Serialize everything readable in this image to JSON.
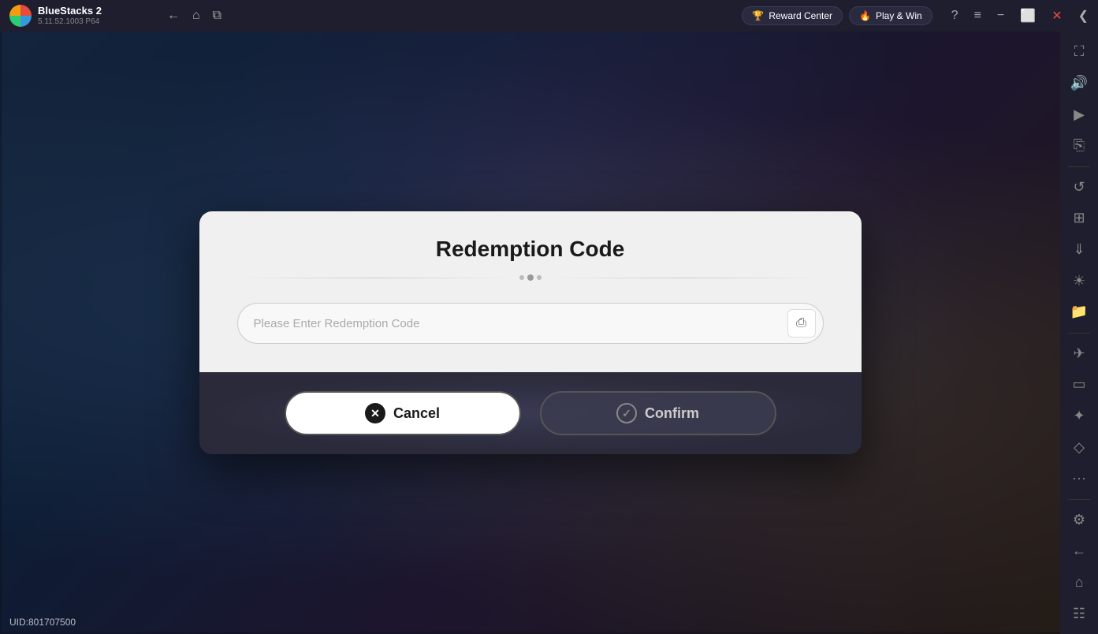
{
  "app": {
    "name": "BlueStacks 2",
    "version": "5.11.52.1003  P64"
  },
  "titlebar": {
    "back_label": "←",
    "home_label": "⌂",
    "copy_label": "⧉",
    "reward_center_label": "Reward Center",
    "play_win_label": "Play & Win",
    "help_label": "?",
    "menu_label": "≡",
    "minimize_label": "−",
    "restore_label": "⬜",
    "close_label": "✕",
    "arrow_label": "❮"
  },
  "sidebar": {
    "icons": [
      {
        "name": "expand-icon",
        "symbol": "⛶"
      },
      {
        "name": "volume-icon",
        "symbol": "🔊"
      },
      {
        "name": "video-icon",
        "symbol": "▶"
      },
      {
        "name": "camera-icon",
        "symbol": "📷"
      },
      {
        "name": "refresh-icon",
        "symbol": "↺"
      },
      {
        "name": "apps-icon",
        "symbol": "⊞"
      },
      {
        "name": "import-icon",
        "symbol": "📥"
      },
      {
        "name": "screenshot-icon",
        "symbol": "📸"
      },
      {
        "name": "folder-icon",
        "symbol": "📁"
      },
      {
        "name": "flight-icon",
        "symbol": "✈"
      },
      {
        "name": "phone-icon",
        "symbol": "📱"
      },
      {
        "name": "macro-icon",
        "symbol": "⬡"
      },
      {
        "name": "pin-icon",
        "symbol": "📍"
      },
      {
        "name": "more-icon",
        "symbol": "···"
      },
      {
        "name": "settings-icon",
        "symbol": "⚙"
      },
      {
        "name": "back-icon",
        "symbol": "←"
      },
      {
        "name": "home2-icon",
        "symbol": "⌂"
      },
      {
        "name": "page-icon",
        "symbol": "📄"
      }
    ]
  },
  "dialog": {
    "title": "Redemption Code",
    "input_placeholder": "Please Enter Redemption Code",
    "cancel_label": "Cancel",
    "confirm_label": "Confirm"
  },
  "uid": {
    "label": "UID:801707500"
  }
}
